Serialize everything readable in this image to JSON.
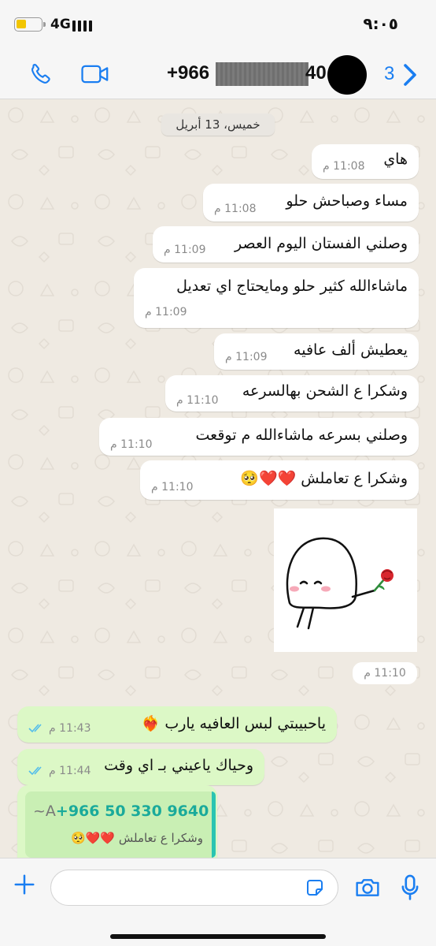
{
  "status_bar": {
    "network": "4G",
    "time": "٩:٠٥"
  },
  "header": {
    "contact_prefix": "+966",
    "contact_suffix": "40",
    "back_count": "3",
    "icons": [
      "phone-icon",
      "video-icon",
      "chevron-left-icon"
    ],
    "accent_color": "#1a7ef1"
  },
  "chat": {
    "date_label": "خميس، 13 أبريل",
    "messages": [
      {
        "text": "هاي",
        "time": "11:08 م"
      },
      {
        "text": "مساء وصباحش حلو",
        "time": "11:08 م"
      },
      {
        "text": "وصلني الفستان اليوم العصر",
        "time": "11:09 م"
      },
      {
        "text": "ماشاءالله كثير حلو ومايحتاج اي تعديل",
        "time": "11:09 م"
      },
      {
        "text": "يعطيش ألف عافيه",
        "time": "11:09 م"
      },
      {
        "text": "وشكرا ع الشحن بهالسرعه",
        "time": "11:10 م"
      },
      {
        "text": "وصلني بسرعه ماشاءالله م توقعت",
        "time": "11:10 م"
      },
      {
        "text": "وشكرا ع تعاملش ❤️❤️🥺",
        "time": "11:10 م"
      }
    ],
    "sticker_time": "11:10 م",
    "outgoing": [
      {
        "text": "ياحبيبتي لبس العافيه يارب ❤️‍🔥",
        "time": "11:43 م"
      },
      {
        "text": "وحياك ياعيني بـ اي وقت",
        "time": "11:44 م"
      }
    ],
    "reply_preview": {
      "tilde": "~A",
      "number": "+966 50 330 9640",
      "text": "وشكرا ع تعاملش ❤️❤️🥺"
    },
    "colors": {
      "incoming_bubble": "#ffffff",
      "outgoing_bubble": "#dcf8c6",
      "read_ticks": "#53bdeb"
    }
  },
  "input_bar": {
    "placeholder": "",
    "icons": [
      "plus-icon",
      "sticker-icon",
      "camera-icon",
      "microphone-icon"
    ]
  }
}
